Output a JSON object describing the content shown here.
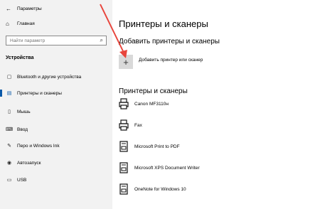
{
  "window": {
    "title": "Параметры"
  },
  "sidebar": {
    "home_label": "Главная",
    "search_placeholder": "Найти параметр",
    "section_title": "Устройства",
    "items": [
      {
        "label": "Bluetooth и другие устройства",
        "icon": "bluetooth-icon"
      },
      {
        "label": "Принтеры и сканеры",
        "icon": "printer-icon",
        "active": true
      },
      {
        "label": "Мышь",
        "icon": "mouse-icon"
      },
      {
        "label": "Ввод",
        "icon": "keyboard-icon"
      },
      {
        "label": "Перо и Windows Ink",
        "icon": "pen-icon"
      },
      {
        "label": "Автозапуск",
        "icon": "autoplay-icon"
      },
      {
        "label": "USB",
        "icon": "usb-icon"
      }
    ]
  },
  "main": {
    "title": "Принтеры и сканеры",
    "add_section_title": "Добавить принтеры и сканеры",
    "add_button_label": "Добавить принтер или сканер",
    "list_title": "Принтеры и сканеры",
    "printers": [
      {
        "name": "Canon MF3110н"
      },
      {
        "name": "Fax"
      },
      {
        "name": "Microsoft Print to PDF"
      },
      {
        "name": "Microsoft XPS Document Writer"
      },
      {
        "name": "OneNote for Windows 10"
      }
    ]
  },
  "colors": {
    "accent": "#0a59a8",
    "annotation_arrow": "#e8453c"
  }
}
